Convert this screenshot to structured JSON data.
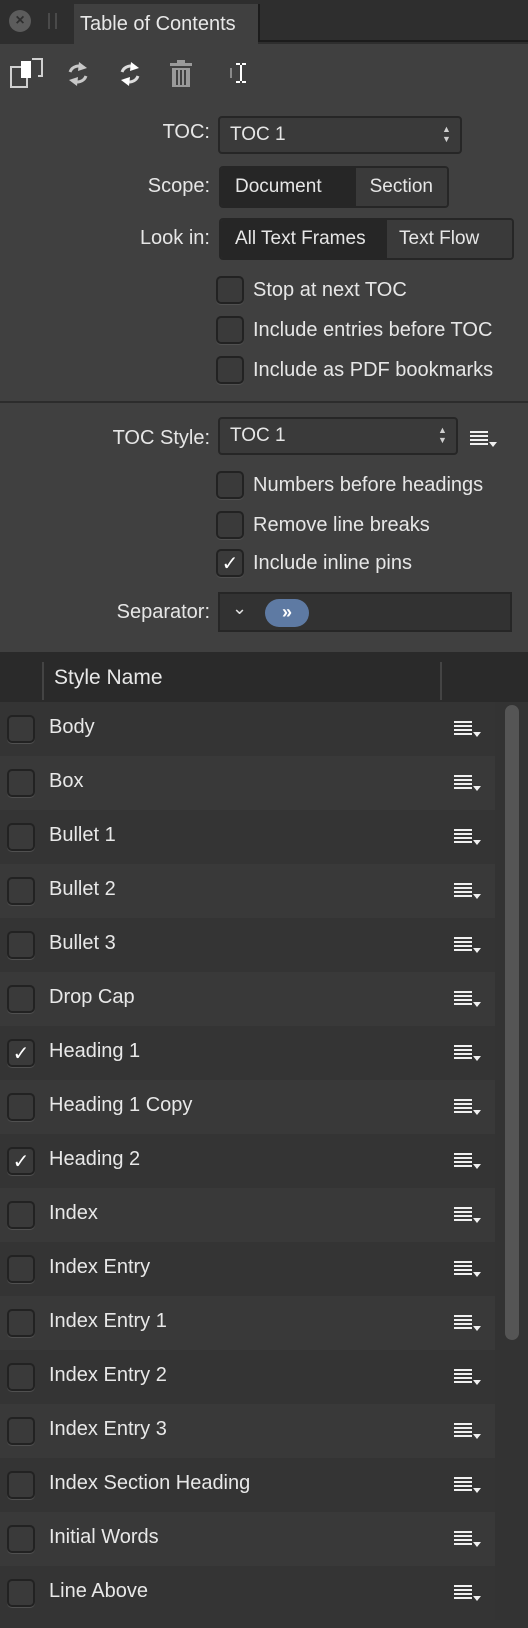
{
  "panel": {
    "tab_title": "Table of Contents",
    "close_icon": "close-icon",
    "grip_icon": "panel-grip-icon"
  },
  "toolbar": {
    "buttons": [
      {
        "name": "insert-toc-button",
        "icon": "duplicate-frames-icon"
      },
      {
        "name": "update-toc-button",
        "icon": "refresh-icon"
      },
      {
        "name": "update-all-toc-button",
        "icon": "refresh-all-icon"
      },
      {
        "name": "delete-toc-button",
        "icon": "trash-icon"
      },
      {
        "name": "text-cursor-button",
        "icon": "text-cursor-icon"
      }
    ]
  },
  "toc": {
    "label": "TOC:",
    "value": "TOC 1"
  },
  "scope": {
    "label": "Scope:",
    "options": [
      "Document",
      "Section"
    ],
    "selected": "Document"
  },
  "look_in": {
    "label": "Look in:",
    "options": [
      "All Text Frames",
      "Text Flow"
    ],
    "selected": "All Text Frames"
  },
  "options1": [
    {
      "label": "Stop at next TOC",
      "checked": false
    },
    {
      "label": "Include entries before TOC",
      "checked": false
    },
    {
      "label": "Include as PDF bookmarks",
      "checked": false
    }
  ],
  "toc_style": {
    "label": "TOC Style:",
    "value": "TOC 1",
    "menu_icon": "style-menu-icon"
  },
  "options2": [
    {
      "label": "Numbers before headings",
      "checked": false
    },
    {
      "label": "Remove line breaks",
      "checked": false
    },
    {
      "label": "Include inline pins",
      "checked": true
    }
  ],
  "separator": {
    "label": "Separator:",
    "chevron": "⌄",
    "token": "»"
  },
  "list": {
    "header": "Style Name",
    "rows": [
      {
        "name": "Body",
        "checked": false
      },
      {
        "name": "Box",
        "checked": false
      },
      {
        "name": "Bullet 1",
        "checked": false
      },
      {
        "name": "Bullet 2",
        "checked": false
      },
      {
        "name": "Bullet 3",
        "checked": false
      },
      {
        "name": "Drop Cap",
        "checked": false
      },
      {
        "name": "Heading 1",
        "checked": true
      },
      {
        "name": "Heading 1 Copy",
        "checked": false
      },
      {
        "name": "Heading 2",
        "checked": true
      },
      {
        "name": "Index",
        "checked": false
      },
      {
        "name": "Index Entry",
        "checked": false
      },
      {
        "name": "Index Entry 1",
        "checked": false
      },
      {
        "name": "Index Entry 2",
        "checked": false
      },
      {
        "name": "Index Entry 3",
        "checked": false
      },
      {
        "name": "Index Section Heading",
        "checked": false
      },
      {
        "name": "Initial Words",
        "checked": false
      },
      {
        "name": "Line Above",
        "checked": false
      }
    ]
  },
  "colors": {
    "panel_bg": "#404040",
    "accent_token": "#5e7aa3"
  }
}
